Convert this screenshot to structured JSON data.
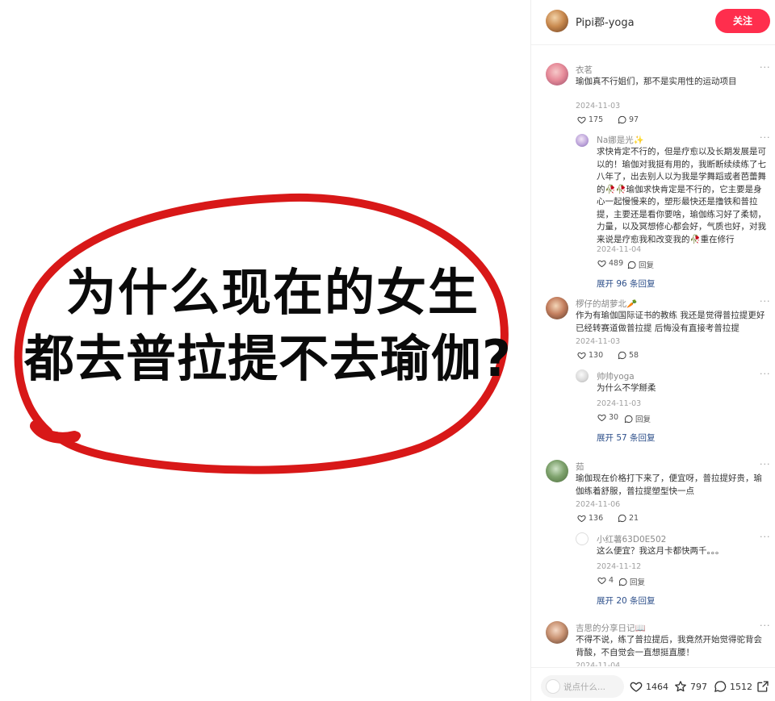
{
  "image": {
    "title_line1": "为什么现在的女生",
    "title_line2": "都去普拉提不去瑜伽?",
    "circle_color": "#d81818"
  },
  "author": {
    "name": "Pipi郡-yoga",
    "follow_label": "关注",
    "follow_color": "#ff2e4d"
  },
  "comments": [
    {
      "name": "衣茗",
      "text": "瑜伽真不行姐们，那不是实用性的运动项目",
      "date": "2024-11-03",
      "likes": "175",
      "replies": "97",
      "reply": {
        "name": "Na娜是光✨",
        "text": "求快肯定不行的，但是疗愈以及长期发展是可以的！瑜伽对我挺有用的，我断断续续练了七八年了，出去别人以为我是学舞蹈或者芭蕾舞的🥀🥀瑜伽求快肯定是不行的，它主要是身心一起慢慢来的，塑形最快还是撸铁和普拉提，主要还是看你要啥，瑜伽练习好了柔韧，力量，以及冥想修心都会好，气质也好，对我来说是疗愈我和改变我的🥀重在修行",
        "date": "2024-11-04",
        "likes": "489",
        "reply_label": "回复"
      },
      "expand_label": "展开 96 条回复"
    },
    {
      "name": "椤仔的胡萝北🥕",
      "text": "作为有瑜伽国际证书的教练 我还是觉得普拉提更好 已经转赛道做普拉提 后悔没有直接考普拉提",
      "date": "2024-11-03",
      "likes": "130",
      "replies": "58",
      "reply": {
        "name": "帅帅yoga",
        "text": "为什么不学掰柔",
        "date": "2024-11-03",
        "likes": "30",
        "reply_label": "回复"
      },
      "expand_label": "展开 57 条回复"
    },
    {
      "name": "茹",
      "text": "瑜伽现在价格打下来了，便宜呀，普拉提好贵，瑜伽练着舒服，普拉提塑型快一点",
      "date": "2024-11-06",
      "likes": "136",
      "replies": "21",
      "reply": {
        "name": "小红薯63D0E502",
        "text": "这么便宜？我这月卡都快两千。。。",
        "date": "2024-11-12",
        "likes": "4",
        "reply_label": "回复"
      },
      "expand_label": "展开 20 条回复"
    },
    {
      "name": "吉思的分享日记📖",
      "text": "不得不说，练了普拉提后，我竟然开始觉得驼背会背酸，不自觉会一直想挺直腰！",
      "date": "2024-11-04"
    }
  ],
  "more_icon": "···",
  "bottom": {
    "placeholder": "说点什么...",
    "likes": "1464",
    "collects": "797",
    "comments": "1512"
  }
}
